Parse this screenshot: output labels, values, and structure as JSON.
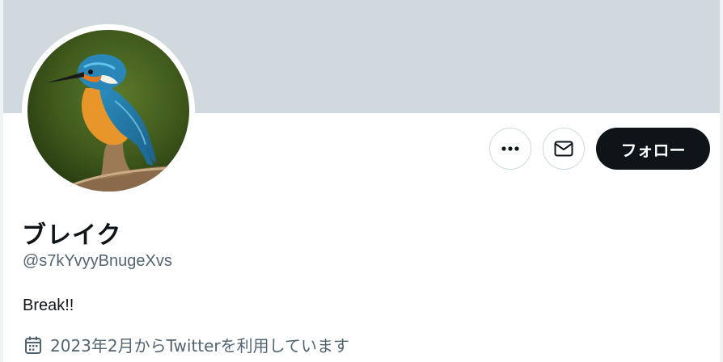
{
  "profile": {
    "display_name": "ブレイク",
    "handle": "@s7kYvyyBnugeXvs",
    "bio": "Break!!",
    "joined": "2023年2月からTwitterを利用しています"
  },
  "actions": {
    "more_icon": "more-dots-icon",
    "message_icon": "envelope-icon",
    "follow_label": "フォロー"
  },
  "colors": {
    "banner": "#cfd9de",
    "follow_button_bg": "#0f1419",
    "secondary_text": "#536471"
  }
}
